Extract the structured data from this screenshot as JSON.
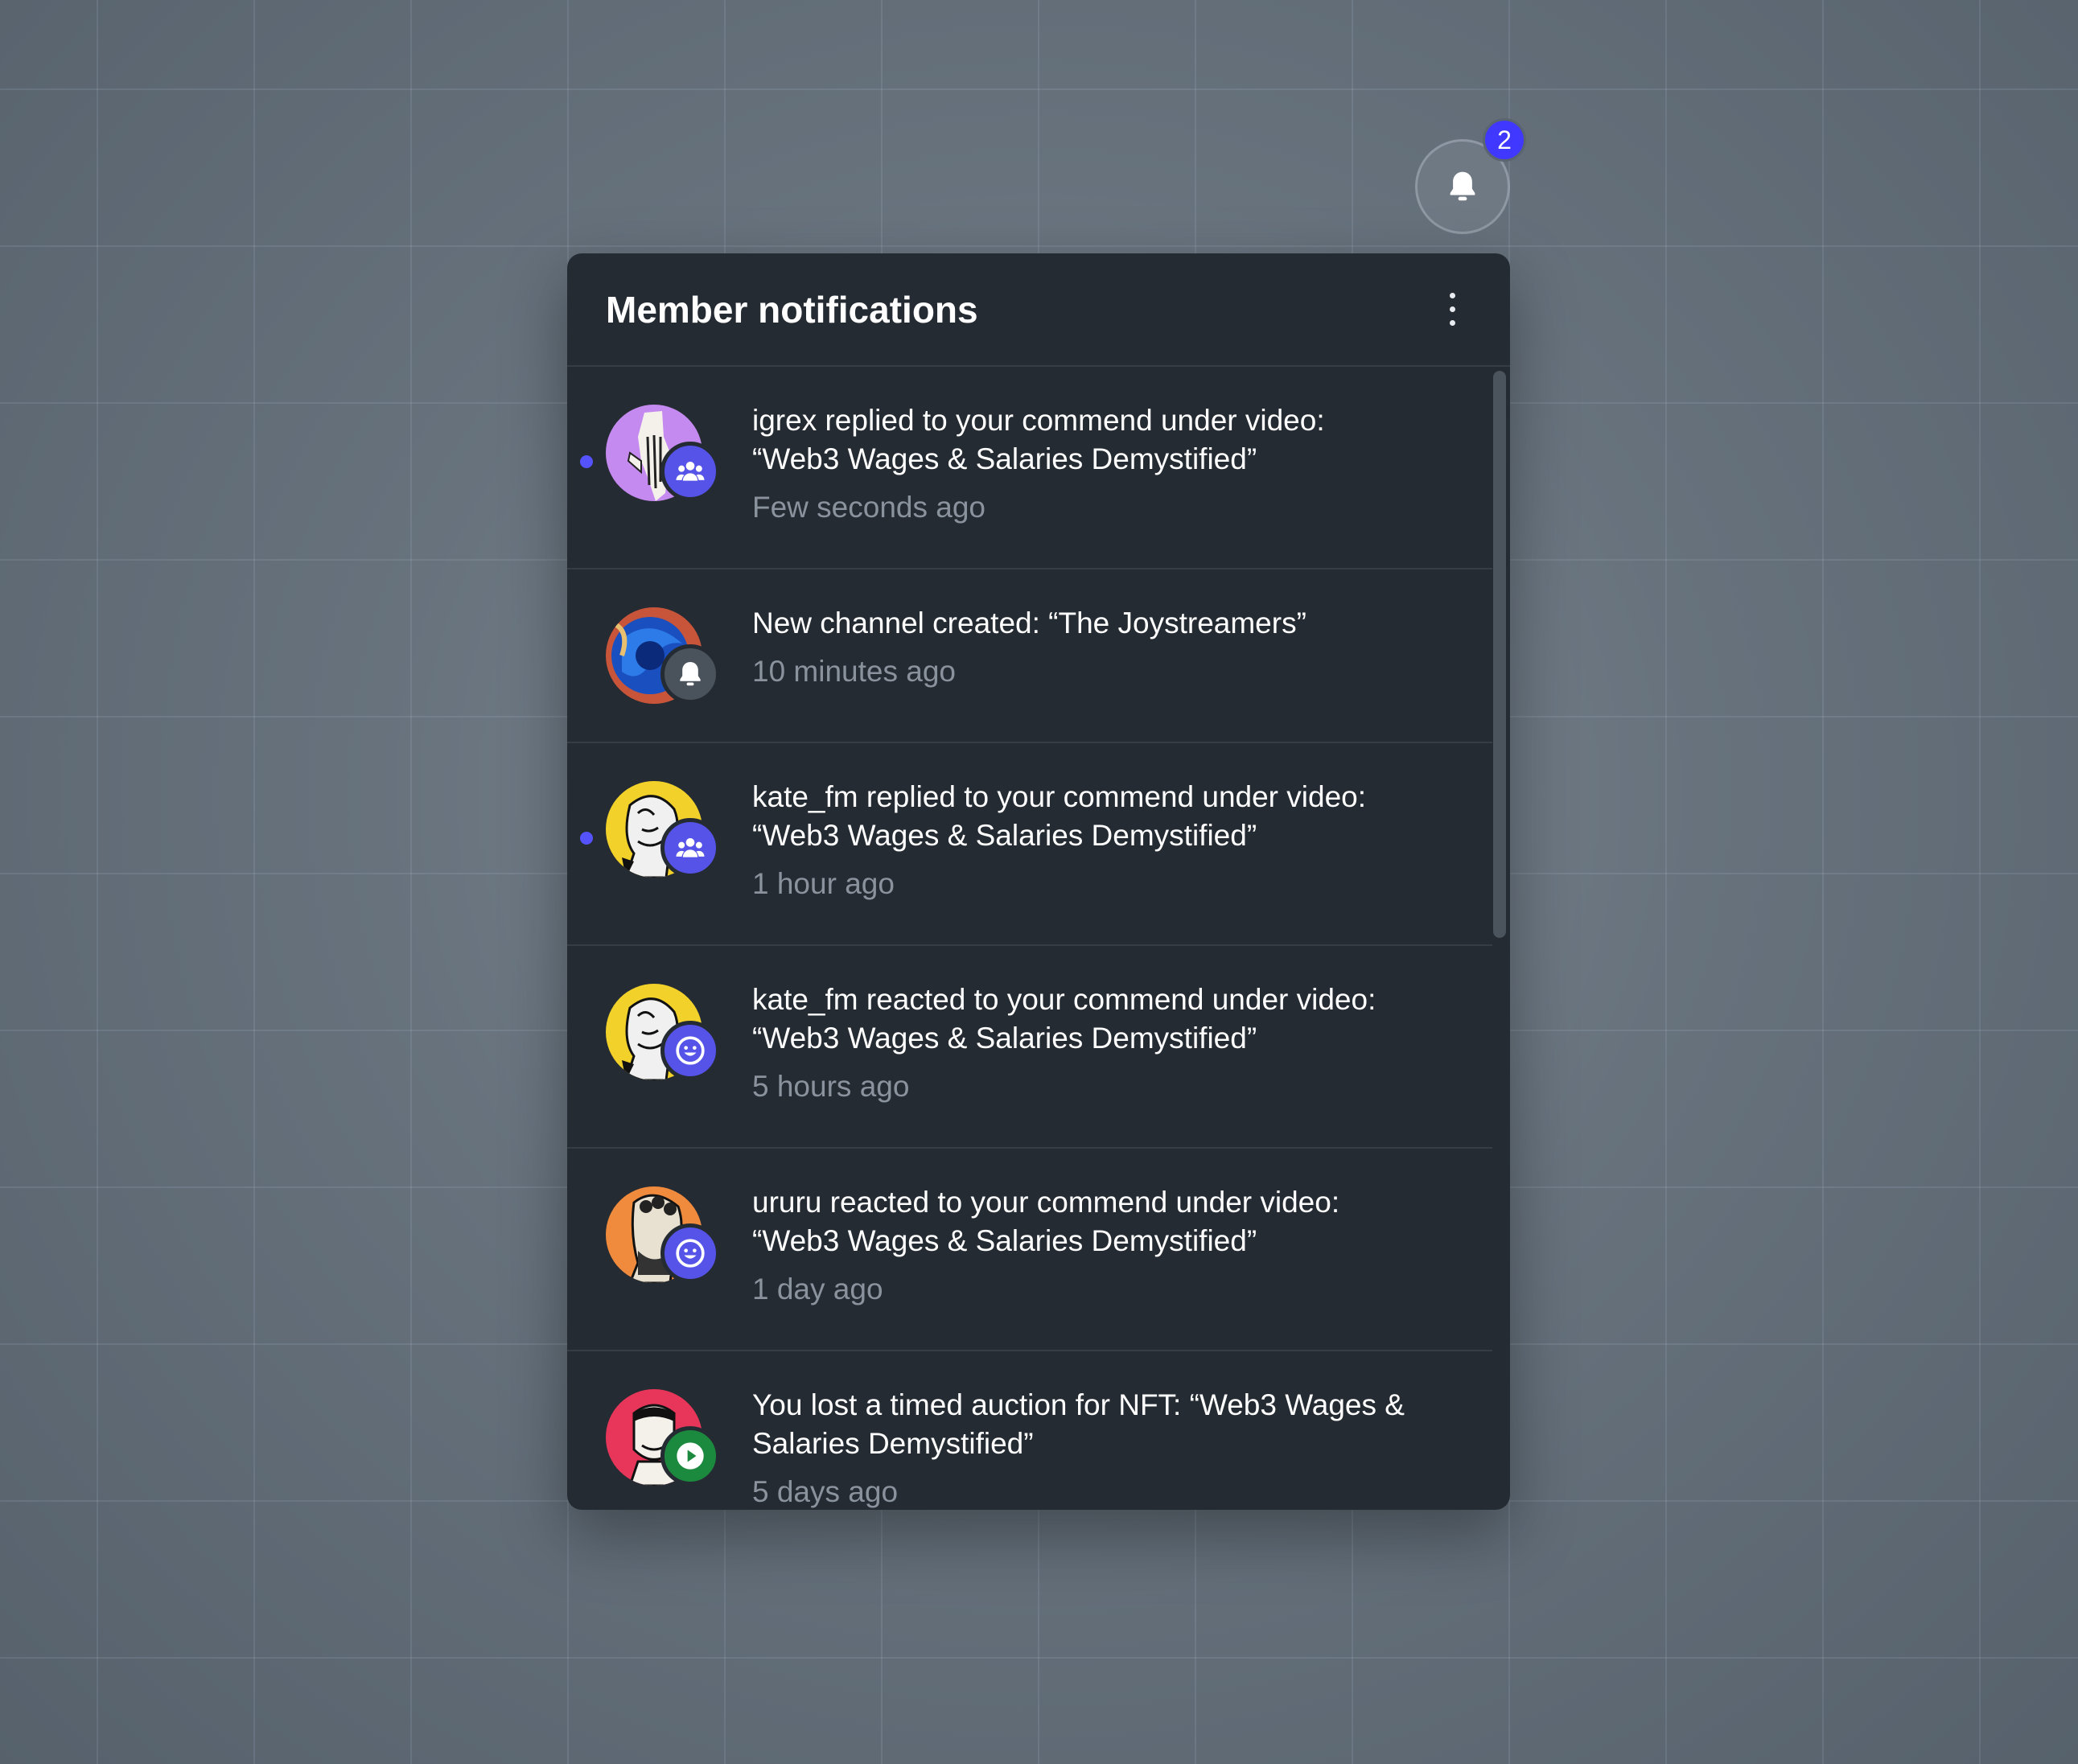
{
  "bell": {
    "badge_count": "2",
    "icon": "bell-icon"
  },
  "panel": {
    "title": "Member notifications",
    "menu_icon": "kebab-menu-icon"
  },
  "notifications": [
    {
      "line1": "igrex replied to your commend under video:",
      "line2": "“Web3 Wages & Salaries Demystified”",
      "time": "Few seconds ago",
      "unread": true,
      "badge": "members-icon"
    },
    {
      "line1": "New channel created: “The Joystreamers”",
      "line2": "",
      "time": "10 minutes ago",
      "unread": false,
      "badge": "bell-icon"
    },
    {
      "line1": "kate_fm replied to your commend under video:",
      "line2": "“Web3 Wages & Salaries Demystified”",
      "time": "1 hour ago",
      "unread": true,
      "badge": "members-icon"
    },
    {
      "line1": "kate_fm reacted to your commend under video:",
      "line2": "“Web3 Wages & Salaries Demystified”",
      "time": "5 hours ago",
      "unread": false,
      "badge": "smiley-icon"
    },
    {
      "line1": "ururu reacted to your commend under video:",
      "line2": "“Web3 Wages & Salaries Demystified”",
      "time": "1 day ago",
      "unread": false,
      "badge": "smiley-icon"
    },
    {
      "line1": "You lost a timed auction for NFT: “Web3 Wages &",
      "line2": "Salaries Demystified”",
      "time": "5 days ago",
      "unread": false,
      "badge": "play-icon"
    }
  ],
  "colors": {
    "accent": "#4038ff",
    "panel_bg": "#252b32",
    "unread_dot": "#5553ff"
  }
}
